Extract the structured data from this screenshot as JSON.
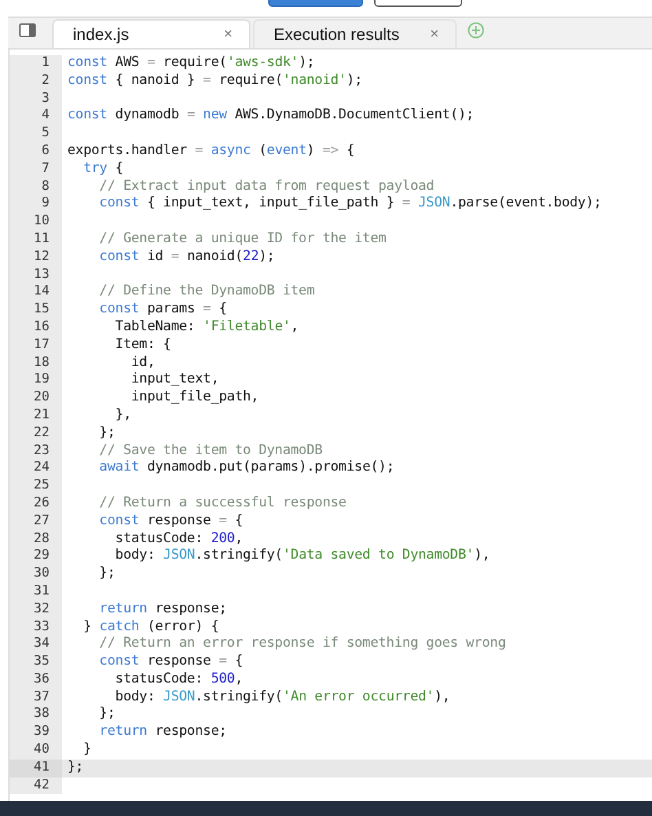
{
  "tabs": [
    {
      "label": "index.js",
      "selected": true,
      "close": "×"
    },
    {
      "label": "Execution results",
      "selected": false,
      "close": "×"
    }
  ],
  "lines": [
    {
      "number": "1",
      "active": false,
      "tokens": [
        {
          "kind": "kw",
          "text": "const"
        },
        {
          "kind": "plain",
          "text": " AWS "
        },
        {
          "kind": "op",
          "text": "="
        },
        {
          "kind": "plain",
          "text": " require("
        },
        {
          "kind": "str",
          "text": "'aws-sdk'"
        },
        {
          "kind": "plain",
          "text": ");"
        }
      ]
    },
    {
      "number": "2",
      "active": false,
      "tokens": [
        {
          "kind": "kw",
          "text": "const"
        },
        {
          "kind": "plain",
          "text": " { nanoid } "
        },
        {
          "kind": "op",
          "text": "="
        },
        {
          "kind": "plain",
          "text": " require("
        },
        {
          "kind": "str",
          "text": "'nanoid'"
        },
        {
          "kind": "plain",
          "text": ");"
        }
      ]
    },
    {
      "number": "3",
      "active": false
    },
    {
      "number": "4",
      "active": false,
      "tokens": [
        {
          "kind": "kw",
          "text": "const"
        },
        {
          "kind": "plain",
          "text": " dynamodb "
        },
        {
          "kind": "op",
          "text": "="
        },
        {
          "kind": "kw",
          "text": " new"
        },
        {
          "kind": "plain",
          "text": " AWS.DynamoDB.DocumentClient();"
        }
      ]
    },
    {
      "number": "5",
      "active": false
    },
    {
      "number": "6",
      "active": false,
      "tokens": [
        {
          "kind": "plain",
          "text": "exports.handler "
        },
        {
          "kind": "op",
          "text": "="
        },
        {
          "kind": "kw",
          "text": " async"
        },
        {
          "kind": "plain",
          "text": " ("
        },
        {
          "kind": "kw",
          "text": "event"
        },
        {
          "kind": "plain",
          "text": ") "
        },
        {
          "kind": "op",
          "text": "=>"
        },
        {
          "kind": "plain",
          "text": " {"
        }
      ]
    },
    {
      "number": "7",
      "active": false,
      "tokens": [
        {
          "kind": "kw",
          "text": "  try"
        },
        {
          "kind": "plain",
          "text": " {"
        }
      ]
    },
    {
      "number": "8",
      "active": false,
      "tokens": [
        {
          "kind": "cm",
          "text": "    // Extract input data from request payload"
        }
      ]
    },
    {
      "number": "9",
      "active": false,
      "tokens": [
        {
          "kind": "kw",
          "text": "    const"
        },
        {
          "kind": "plain",
          "text": " { input_text, input_file_path } "
        },
        {
          "kind": "op",
          "text": "="
        },
        {
          "kind": "bi",
          "text": " JSON"
        },
        {
          "kind": "plain",
          "text": ".parse(event.body);"
        }
      ]
    },
    {
      "number": "10",
      "active": false
    },
    {
      "number": "11",
      "active": false,
      "tokens": [
        {
          "kind": "cm",
          "text": "    // Generate a unique ID for the item"
        }
      ]
    },
    {
      "number": "12",
      "active": false,
      "tokens": [
        {
          "kind": "kw",
          "text": "    const"
        },
        {
          "kind": "plain",
          "text": " id "
        },
        {
          "kind": "op",
          "text": "="
        },
        {
          "kind": "plain",
          "text": " nanoid("
        },
        {
          "kind": "num",
          "text": "22"
        },
        {
          "kind": "plain",
          "text": ");"
        }
      ]
    },
    {
      "number": "13",
      "active": false
    },
    {
      "number": "14",
      "active": false,
      "tokens": [
        {
          "kind": "cm",
          "text": "    // Define the DynamoDB item"
        }
      ]
    },
    {
      "number": "15",
      "active": false,
      "tokens": [
        {
          "kind": "kw",
          "text": "    const"
        },
        {
          "kind": "plain",
          "text": " params "
        },
        {
          "kind": "op",
          "text": "="
        },
        {
          "kind": "plain",
          "text": " {"
        }
      ]
    },
    {
      "number": "16",
      "active": false,
      "tokens": [
        {
          "kind": "plain",
          "text": "      TableName: "
        },
        {
          "kind": "str",
          "text": "'Filetable'"
        },
        {
          "kind": "plain",
          "text": ","
        }
      ]
    },
    {
      "number": "17",
      "active": false,
      "tokens": [
        {
          "kind": "plain",
          "text": "      Item: {"
        }
      ]
    },
    {
      "number": "18",
      "active": false,
      "tokens": [
        {
          "kind": "plain",
          "text": "        id,"
        }
      ]
    },
    {
      "number": "19",
      "active": false,
      "tokens": [
        {
          "kind": "plain",
          "text": "        input_text,"
        }
      ]
    },
    {
      "number": "20",
      "active": false,
      "tokens": [
        {
          "kind": "plain",
          "text": "        input_file_path,"
        }
      ]
    },
    {
      "number": "21",
      "active": false,
      "tokens": [
        {
          "kind": "plain",
          "text": "      },"
        }
      ]
    },
    {
      "number": "22",
      "active": false,
      "tokens": [
        {
          "kind": "plain",
          "text": "    };"
        }
      ]
    },
    {
      "number": "23",
      "active": false,
      "tokens": [
        {
          "kind": "cm",
          "text": "    // Save the item to DynamoDB"
        }
      ]
    },
    {
      "number": "24",
      "active": false,
      "tokens": [
        {
          "kind": "kw",
          "text": "    await"
        },
        {
          "kind": "plain",
          "text": " dynamodb.put(params).promise();"
        }
      ]
    },
    {
      "number": "25",
      "active": false
    },
    {
      "number": "26",
      "active": false,
      "tokens": [
        {
          "kind": "cm",
          "text": "    // Return a successful response"
        }
      ]
    },
    {
      "number": "27",
      "active": false,
      "tokens": [
        {
          "kind": "kw",
          "text": "    const"
        },
        {
          "kind": "plain",
          "text": " response "
        },
        {
          "kind": "op",
          "text": "="
        },
        {
          "kind": "plain",
          "text": " {"
        }
      ]
    },
    {
      "number": "28",
      "active": false,
      "tokens": [
        {
          "kind": "plain",
          "text": "      statusCode: "
        },
        {
          "kind": "num",
          "text": "200"
        },
        {
          "kind": "plain",
          "text": ","
        }
      ]
    },
    {
      "number": "29",
      "active": false,
      "tokens": [
        {
          "kind": "plain",
          "text": "      body: "
        },
        {
          "kind": "bi",
          "text": "JSON"
        },
        {
          "kind": "plain",
          "text": ".stringify("
        },
        {
          "kind": "str",
          "text": "'Data saved to DynamoDB'"
        },
        {
          "kind": "plain",
          "text": "),"
        }
      ]
    },
    {
      "number": "30",
      "active": false,
      "tokens": [
        {
          "kind": "plain",
          "text": "    };"
        }
      ]
    },
    {
      "number": "31",
      "active": false
    },
    {
      "number": "32",
      "active": false,
      "tokens": [
        {
          "kind": "kw",
          "text": "    return"
        },
        {
          "kind": "plain",
          "text": " response;"
        }
      ]
    },
    {
      "number": "33",
      "active": false,
      "tokens": [
        {
          "kind": "plain",
          "text": "  } "
        },
        {
          "kind": "kw",
          "text": "catch"
        },
        {
          "kind": "plain",
          "text": " (error) {"
        }
      ]
    },
    {
      "number": "34",
      "active": false,
      "tokens": [
        {
          "kind": "cm",
          "text": "    // Return an error response if something goes wrong"
        }
      ]
    },
    {
      "number": "35",
      "active": false,
      "tokens": [
        {
          "kind": "kw",
          "text": "    const"
        },
        {
          "kind": "plain",
          "text": " response "
        },
        {
          "kind": "op",
          "text": "="
        },
        {
          "kind": "plain",
          "text": " {"
        }
      ]
    },
    {
      "number": "36",
      "active": false,
      "tokens": [
        {
          "kind": "plain",
          "text": "      statusCode: "
        },
        {
          "kind": "num",
          "text": "500"
        },
        {
          "kind": "plain",
          "text": ","
        }
      ]
    },
    {
      "number": "37",
      "active": false,
      "tokens": [
        {
          "kind": "plain",
          "text": "      body: "
        },
        {
          "kind": "bi",
          "text": "JSON"
        },
        {
          "kind": "plain",
          "text": ".stringify("
        },
        {
          "kind": "str",
          "text": "'An error occurred'"
        },
        {
          "kind": "plain",
          "text": "),"
        }
      ]
    },
    {
      "number": "38",
      "active": false,
      "tokens": [
        {
          "kind": "plain",
          "text": "    };"
        }
      ]
    },
    {
      "number": "39",
      "active": false,
      "tokens": [
        {
          "kind": "kw",
          "text": "    return"
        },
        {
          "kind": "plain",
          "text": " response;"
        }
      ]
    },
    {
      "number": "40",
      "active": false,
      "tokens": [
        {
          "kind": "plain",
          "text": "  }"
        }
      ]
    },
    {
      "number": "41",
      "active": true,
      "tokens": [
        {
          "kind": "plain",
          "text": "};"
        }
      ]
    },
    {
      "number": "42",
      "active": false
    }
  ]
}
